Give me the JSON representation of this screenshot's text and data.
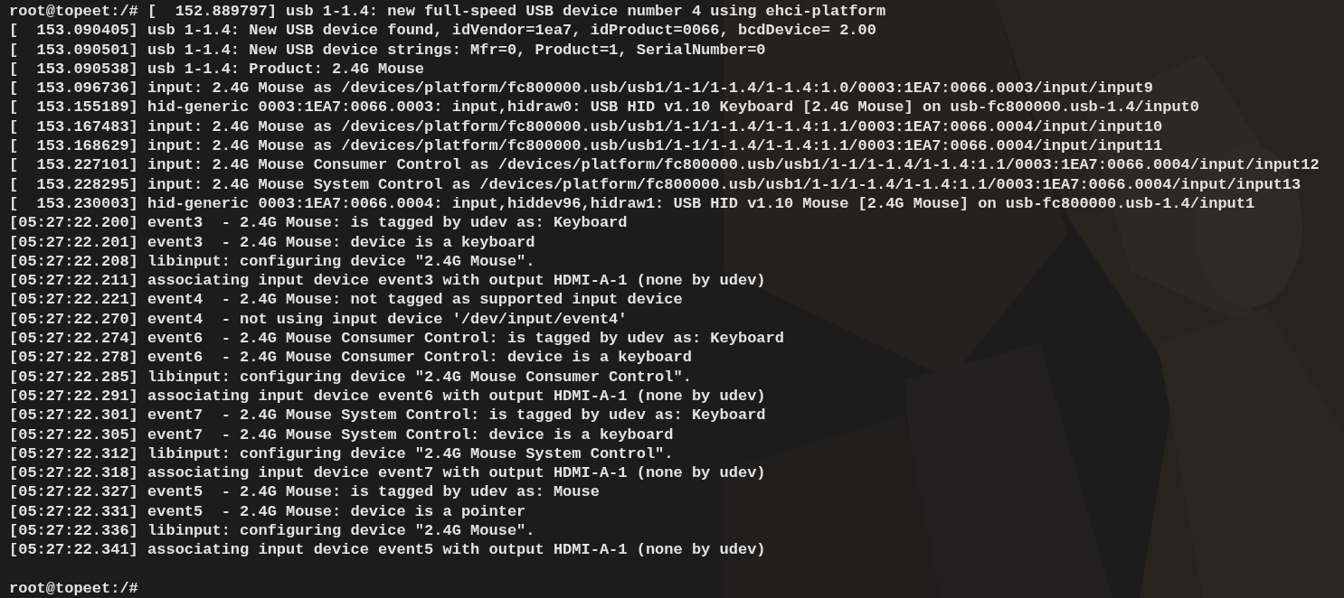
{
  "terminal": {
    "lines": [
      "root@topeet:/# [  152.889797] usb 1-1.4: new full-speed USB device number 4 using ehci-platform",
      "[  153.090405] usb 1-1.4: New USB device found, idVendor=1ea7, idProduct=0066, bcdDevice= 2.00",
      "[  153.090501] usb 1-1.4: New USB device strings: Mfr=0, Product=1, SerialNumber=0",
      "[  153.090538] usb 1-1.4: Product: 2.4G Mouse",
      "[  153.096736] input: 2.4G Mouse as /devices/platform/fc800000.usb/usb1/1-1/1-1.4/1-1.4:1.0/0003:1EA7:0066.0003/input/input9",
      "[  153.155189] hid-generic 0003:1EA7:0066.0003: input,hidraw0: USB HID v1.10 Keyboard [2.4G Mouse] on usb-fc800000.usb-1.4/input0",
      "[  153.167483] input: 2.4G Mouse as /devices/platform/fc800000.usb/usb1/1-1/1-1.4/1-1.4:1.1/0003:1EA7:0066.0004/input/input10",
      "[  153.168629] input: 2.4G Mouse as /devices/platform/fc800000.usb/usb1/1-1/1-1.4/1-1.4:1.1/0003:1EA7:0066.0004/input/input11",
      "[  153.227101] input: 2.4G Mouse Consumer Control as /devices/platform/fc800000.usb/usb1/1-1/1-1.4/1-1.4:1.1/0003:1EA7:0066.0004/input/input12",
      "[  153.228295] input: 2.4G Mouse System Control as /devices/platform/fc800000.usb/usb1/1-1/1-1.4/1-1.4:1.1/0003:1EA7:0066.0004/input/input13",
      "[  153.230003] hid-generic 0003:1EA7:0066.0004: input,hiddev96,hidraw1: USB HID v1.10 Mouse [2.4G Mouse] on usb-fc800000.usb-1.4/input1",
      "[05:27:22.200] event3  - 2.4G Mouse: is tagged by udev as: Keyboard",
      "[05:27:22.201] event3  - 2.4G Mouse: device is a keyboard",
      "[05:27:22.208] libinput: configuring device \"2.4G Mouse\".",
      "[05:27:22.211] associating input device event3 with output HDMI-A-1 (none by udev)",
      "[05:27:22.221] event4  - 2.4G Mouse: not tagged as supported input device",
      "[05:27:22.270] event4  - not using input device '/dev/input/event4'",
      "[05:27:22.274] event6  - 2.4G Mouse Consumer Control: is tagged by udev as: Keyboard",
      "[05:27:22.278] event6  - 2.4G Mouse Consumer Control: device is a keyboard",
      "[05:27:22.285] libinput: configuring device \"2.4G Mouse Consumer Control\".",
      "[05:27:22.291] associating input device event6 with output HDMI-A-1 (none by udev)",
      "[05:27:22.301] event7  - 2.4G Mouse System Control: is tagged by udev as: Keyboard",
      "[05:27:22.305] event7  - 2.4G Mouse System Control: device is a keyboard",
      "[05:27:22.312] libinput: configuring device \"2.4G Mouse System Control\".",
      "[05:27:22.318] associating input device event7 with output HDMI-A-1 (none by udev)",
      "[05:27:22.327] event5  - 2.4G Mouse: is tagged by udev as: Mouse",
      "[05:27:22.331] event5  - 2.4G Mouse: device is a pointer",
      "[05:27:22.336] libinput: configuring device \"2.4G Mouse\".",
      "[05:27:22.341] associating input device event5 with output HDMI-A-1 (none by udev)"
    ],
    "prompt": "root@topeet:/#"
  }
}
